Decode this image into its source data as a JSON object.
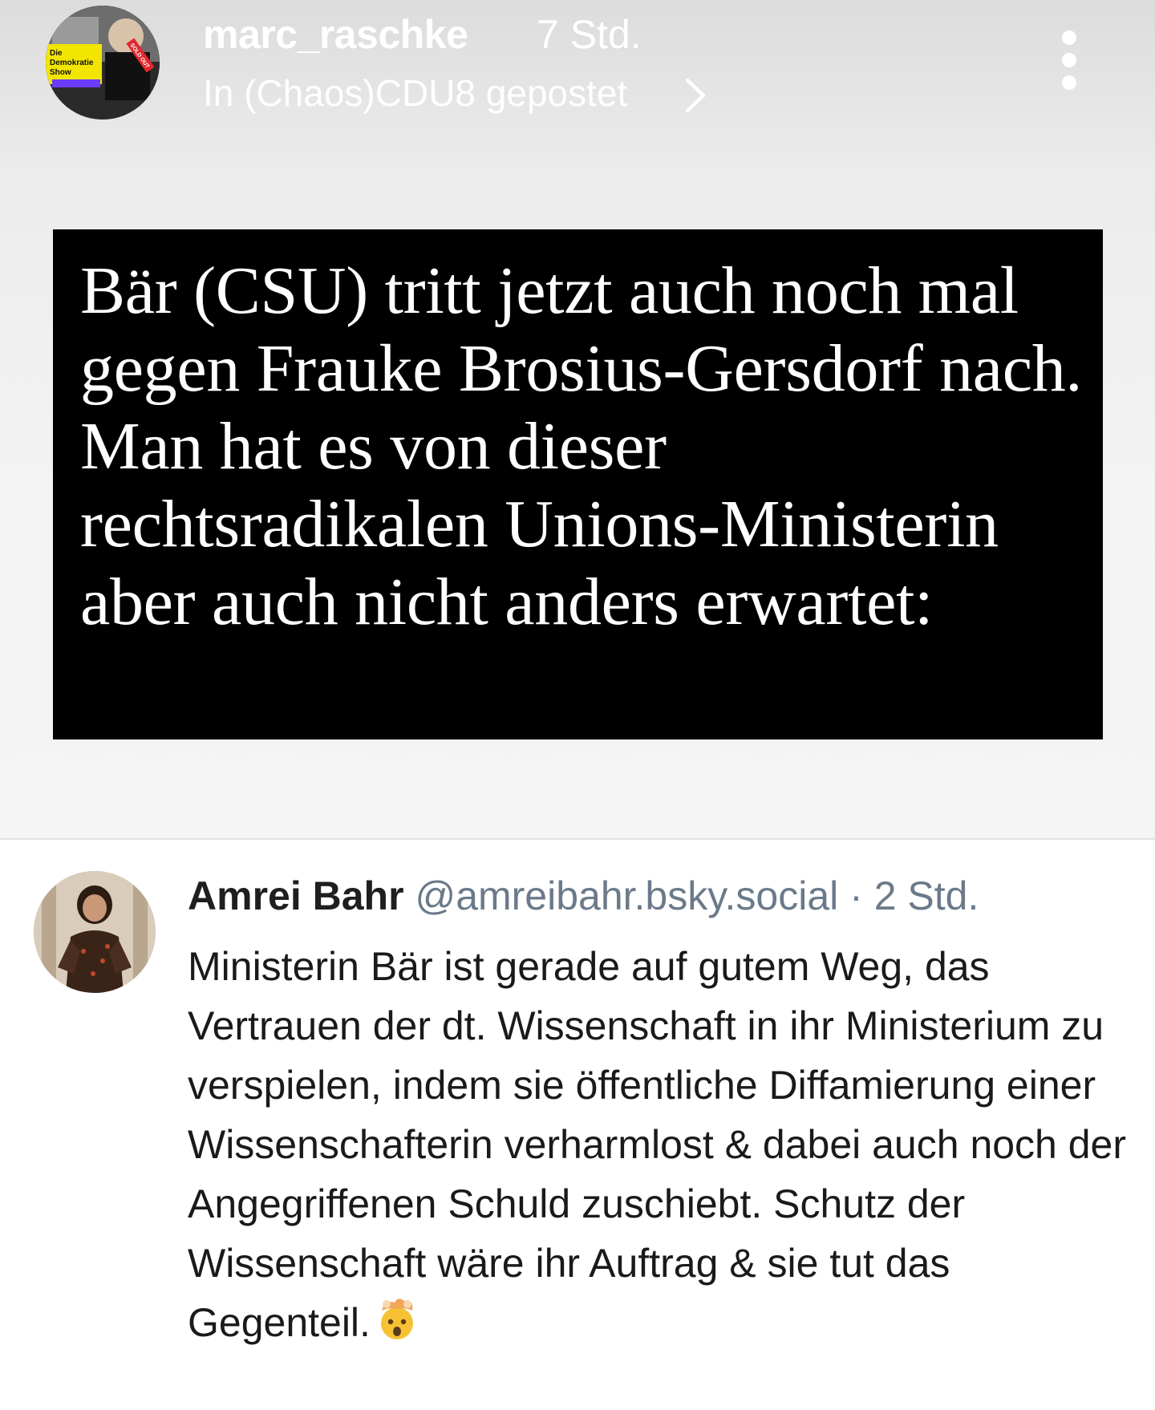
{
  "post": {
    "username": "marc_raschke",
    "time": "7 Std.",
    "posted_in": "In (Chaos)CDU8 gepostet",
    "avatar": {
      "label_line1": "Die",
      "label_line2": "Demokratie",
      "label_line3": "Show",
      "badge": "SOLD OUT"
    },
    "quote": "Bär (CSU) tritt jetzt auch noch mal gegen Frauke Brosius-Gersdorf nach. Man hat es von dieser rechtsradikalen Unions-Ministerin aber auch nicht anders erwartet:"
  },
  "reply": {
    "name": "Amrei Bahr",
    "handle": "@amreibahr.bsky.social",
    "separator": "·",
    "time": "2 Std.",
    "text": "Ministerin Bär ist gerade auf gutem Weg, das Vertrauen der dt. Wissenschaft in ihr Ministerium zu verspielen, indem sie öffentliche Diffamierung einer Wissenschafterin verharmlost & dabei auch noch der Angegriffenen Schuld zuschiebt. Schutz der Wissenschaft wäre ihr Auftrag & sie tut das Gegenteil.",
    "emoji_icon": "exploding-head-icon"
  },
  "icons": {
    "more": "more-vertical-icon",
    "chevron": "chevron-right-icon"
  }
}
